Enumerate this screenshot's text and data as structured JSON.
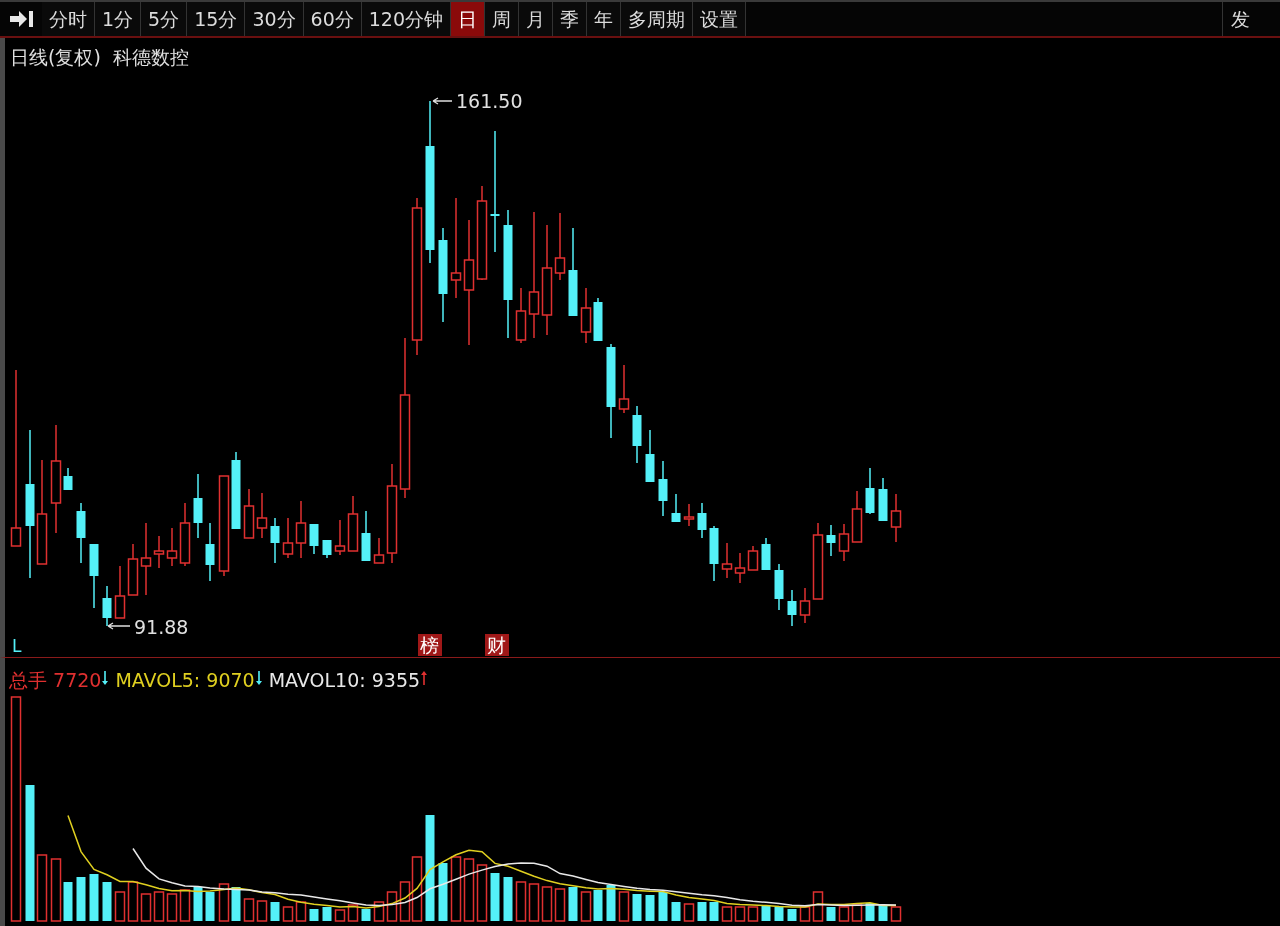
{
  "toolbar": {
    "tabs": [
      {
        "label": "分时",
        "selected": false
      },
      {
        "label": "1分",
        "selected": false
      },
      {
        "label": "5分",
        "selected": false
      },
      {
        "label": "15分",
        "selected": false
      },
      {
        "label": "30分",
        "selected": false
      },
      {
        "label": "60分",
        "selected": false
      },
      {
        "label": "120分钟",
        "selected": false
      },
      {
        "label": "日",
        "selected": true
      },
      {
        "label": "周",
        "selected": false
      },
      {
        "label": "月",
        "selected": false
      },
      {
        "label": "季",
        "selected": false
      },
      {
        "label": "年",
        "selected": false
      },
      {
        "label": "多周期",
        "selected": false
      },
      {
        "label": "设置",
        "selected": false
      }
    ],
    "right_button": "发"
  },
  "chart": {
    "title": "日线(复权)",
    "stock": "科德数控",
    "high_label": "161.50",
    "low_label": "91.88",
    "marker": "L",
    "tags": [
      "榜",
      "财"
    ]
  },
  "volume": {
    "items": [
      {
        "label": "总手",
        "value": "7720",
        "rising": false,
        "color": "#e03030"
      },
      {
        "label": "MAVOL5:",
        "value": "9070",
        "rising": false,
        "color": "#e0d020"
      },
      {
        "label": "MAVOL10:",
        "value": "9355",
        "rising": true,
        "color": "#e8e8e8"
      }
    ]
  }
}
